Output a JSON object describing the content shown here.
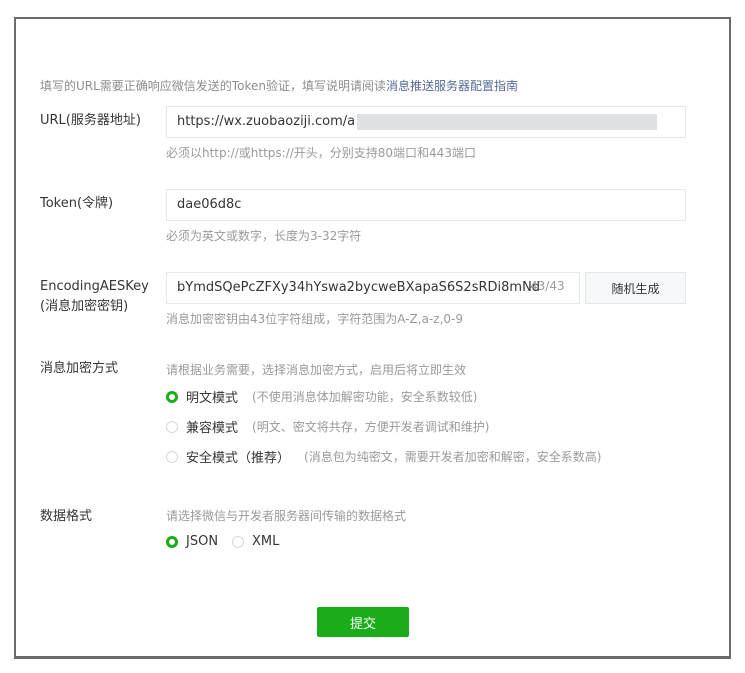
{
  "intro": {
    "text": "填写的URL需要正确响应微信发送的Token验证，填写说明请阅读",
    "link": "消息推送服务器配置指南"
  },
  "url": {
    "label": "URL(服务器地址)",
    "value": "https://wx.zuobaoziji.com/a",
    "hint": "必须以http://或https://开头，分别支持80端口和443端口"
  },
  "token": {
    "label": "Token(令牌)",
    "value": "dae06d8c",
    "hint": "必须为英文或数字，长度为3-32字符"
  },
  "aeskey": {
    "label_line1": "EncodingAESKey",
    "label_line2": "(消息加密密钥)",
    "value": "bYmdSQePcZFXy34hYswa2bycweBXapaS6S2sRDi8mNd",
    "counter": "43/43",
    "generate_button": "随机生成",
    "hint": "消息加密密钥由43位字符组成，字符范围为A-Z,a-z,0-9"
  },
  "encryption": {
    "label": "消息加密方式",
    "hint": "请根据业务需要，选择消息加密方式，启用后将立即生效",
    "options": [
      {
        "label": "明文模式",
        "desc": "(不使用消息体加解密功能，安全系数较低)",
        "selected": true
      },
      {
        "label": "兼容模式",
        "desc": "(明文、密文将共存，方便开发者调试和维护)",
        "selected": false
      },
      {
        "label": "安全模式（推荐）",
        "desc": "(消息包为纯密文，需要开发者加密和解密，安全系数高)",
        "selected": false
      }
    ]
  },
  "format": {
    "label": "数据格式",
    "hint": "请选择微信与开发者服务器间传输的数据格式",
    "options": [
      {
        "label": "JSON",
        "selected": true
      },
      {
        "label": "XML",
        "selected": false
      }
    ]
  },
  "submit_label": "提交",
  "colors": {
    "accent": "#1aad19",
    "link": "#576b95",
    "border": "#6b6b6b"
  }
}
